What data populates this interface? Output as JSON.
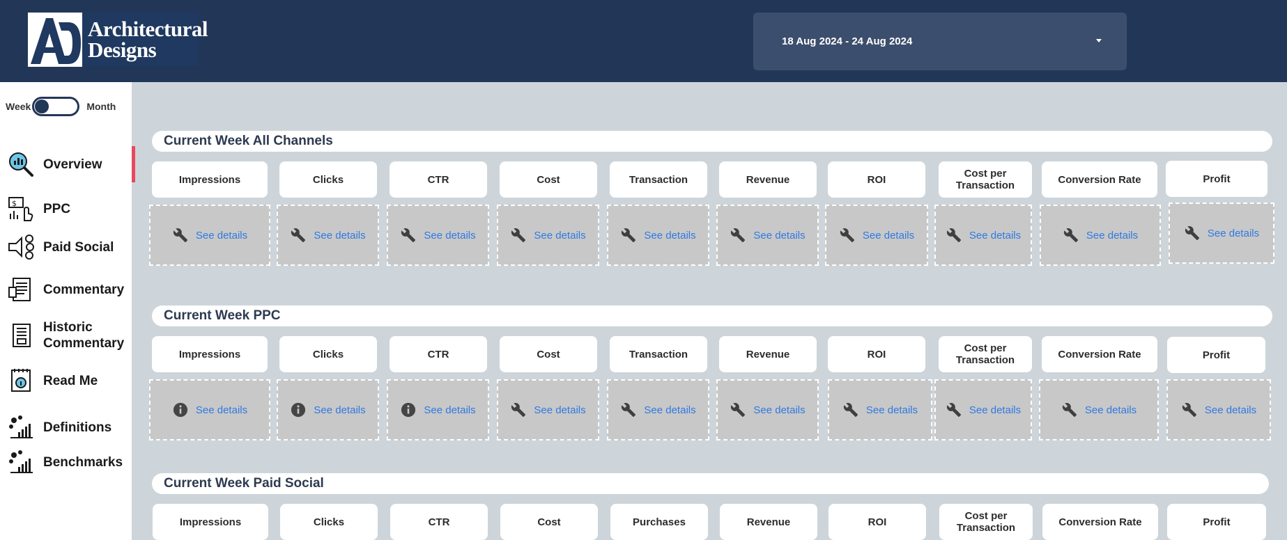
{
  "header": {
    "logo_text": "Architectural Designs",
    "logo_line1": "Architectural",
    "logo_line2": "Designs",
    "logo_mark": "AD",
    "date_range": "18 Aug 2024 - 24 Aug 2024"
  },
  "toggle": {
    "left_label": "Week",
    "right_label": "Month",
    "state": "Week"
  },
  "nav": [
    {
      "label": "Overview",
      "icon": "magnifier-chart-icon",
      "active": true
    },
    {
      "label": "PPC",
      "icon": "ppc-click-icon"
    },
    {
      "label": "Paid Social",
      "icon": "social-network-icon"
    },
    {
      "label": "Commentary",
      "icon": "document-scroll-icon"
    },
    {
      "label_line1": "Historic",
      "label_line2": "Commentary",
      "icon": "historic-document-icon"
    },
    {
      "label": "Read Me",
      "icon": "readme-info-icon"
    },
    {
      "label": "Definitions",
      "icon": "chart-definitions-icon"
    },
    {
      "label": "Benchmarks",
      "icon": "chart-benchmarks-icon"
    }
  ],
  "sections": [
    {
      "title": "Current Week All Channels",
      "metrics": [
        "Impressions",
        "Clicks",
        "CTR",
        "Cost",
        "Transaction",
        "Revenue",
        "ROI",
        "Cost per Transaction",
        "Conversion Rate",
        "Profit"
      ],
      "details": [
        {
          "icon": "wrench-icon",
          "label": "See details"
        },
        {
          "icon": "wrench-icon",
          "label": "See details"
        },
        {
          "icon": "wrench-icon",
          "label": "See details"
        },
        {
          "icon": "wrench-icon",
          "label": "See details"
        },
        {
          "icon": "wrench-icon",
          "label": "See details"
        },
        {
          "icon": "wrench-icon",
          "label": "See details"
        },
        {
          "icon": "wrench-icon",
          "label": "See details"
        },
        {
          "icon": "wrench-icon",
          "label": "See details"
        },
        {
          "icon": "wrench-icon",
          "label": "See details"
        },
        {
          "icon": "wrench-icon",
          "label": "See details"
        }
      ]
    },
    {
      "title": "Current Week PPC",
      "metrics": [
        "Impressions",
        "Clicks",
        "CTR",
        "Cost",
        "Transaction",
        "Revenue",
        "ROI",
        "Cost per Transaction",
        "Conversion Rate",
        "Profit"
      ],
      "details": [
        {
          "icon": "info-icon",
          "label": "See details"
        },
        {
          "icon": "info-icon",
          "label": "See details"
        },
        {
          "icon": "info-icon",
          "label": "See details"
        },
        {
          "icon": "wrench-icon",
          "label": "See details"
        },
        {
          "icon": "wrench-icon",
          "label": "See details"
        },
        {
          "icon": "wrench-icon",
          "label": "See details"
        },
        {
          "icon": "wrench-icon",
          "label": "See details"
        },
        {
          "icon": "wrench-icon",
          "label": "See details"
        },
        {
          "icon": "wrench-icon",
          "label": "See details"
        },
        {
          "icon": "wrench-icon",
          "label": "See details"
        }
      ]
    },
    {
      "title": "Current Week Paid Social",
      "metrics": [
        "Impressions",
        "Clicks",
        "CTR",
        "Cost",
        "Purchases",
        "Revenue",
        "ROI",
        "Cost per Transaction",
        "Conversion Rate",
        "Profit"
      ]
    }
  ],
  "colors": {
    "header_bg": "#223657",
    "page_bg": "#cdd5da",
    "accent_active": "#e8485e",
    "link": "#2f79e2"
  }
}
